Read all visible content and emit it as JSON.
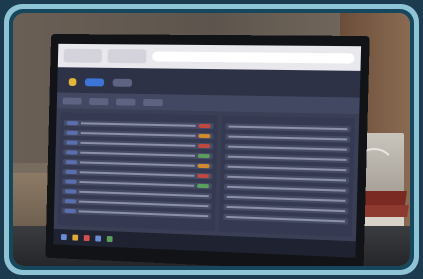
{
  "scene": "photo-of-monitor",
  "app_header": {
    "title": ""
  },
  "colors": {
    "frame": "#1d3b4e",
    "bevel": "#8fc3d6",
    "screen_bg": "#3b3f55",
    "accent": "#3d74d8"
  },
  "panes": {
    "left_rows": 14,
    "right_rows": 14
  }
}
